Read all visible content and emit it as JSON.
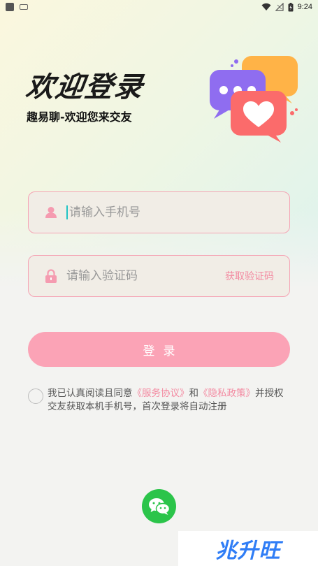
{
  "status_bar": {
    "time": "9:24"
  },
  "header": {
    "title": "欢迎登录",
    "subtitle": "趣易聊-欢迎您来交友"
  },
  "form": {
    "phone_placeholder": "请输入手机号",
    "code_placeholder": "请输入验证码",
    "get_code_label": "获取验证码",
    "login_label": "登录"
  },
  "agreement": {
    "prefix": "我已认真阅读且同意",
    "service_link": "《服务协议》",
    "and": "和",
    "privacy_link": "《隐私政策》",
    "suffix": "并授权交友获取本机手机号，首次登录将自动注册"
  },
  "watermark": {
    "text": "兆升旺"
  },
  "colors": {
    "accent_pink": "#fba3b6",
    "link_pink": "#f38aa1",
    "wechat_green": "#2bc44a"
  },
  "icons": [
    "user-icon",
    "lock-icon",
    "wechat-icon",
    "wifi-icon",
    "signal-icon",
    "battery-icon"
  ]
}
